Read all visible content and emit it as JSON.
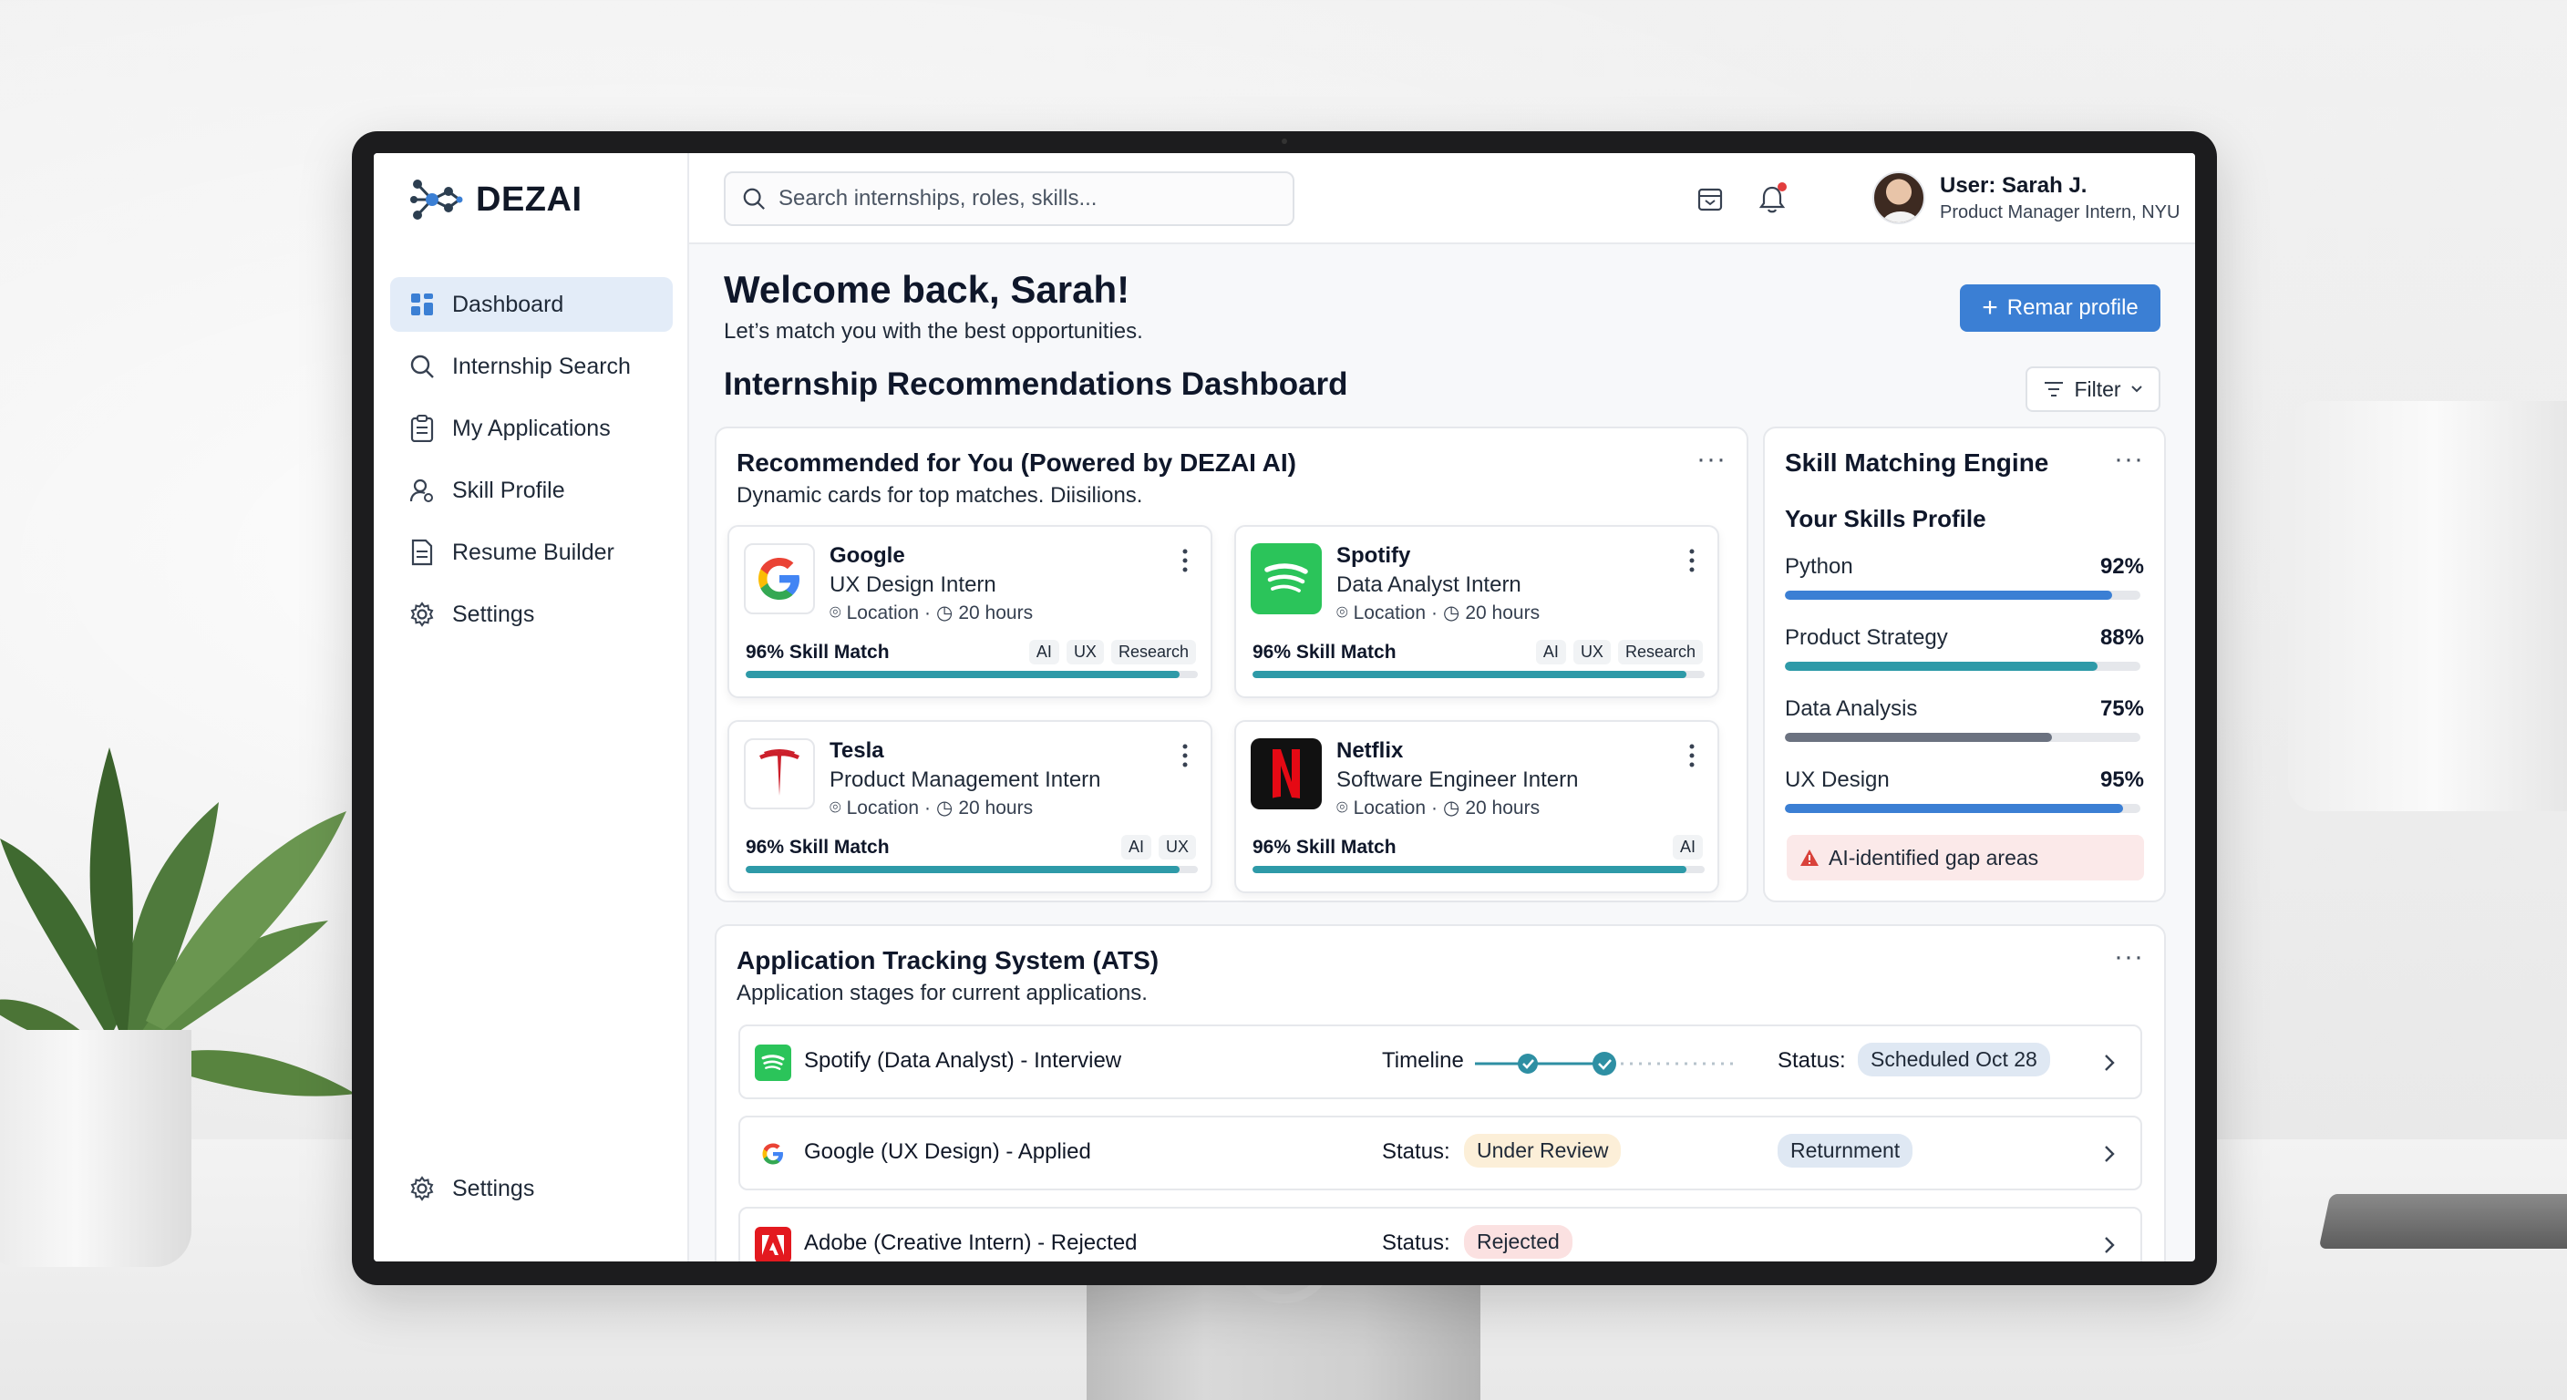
{
  "app": {
    "brand": "DEZAI"
  },
  "sidebar": {
    "items": [
      {
        "label": "Dashboard",
        "icon": "grid-icon",
        "active": true
      },
      {
        "label": "Internship Search",
        "icon": "search-icon"
      },
      {
        "label": "My Applications",
        "icon": "clipboard-icon"
      },
      {
        "label": "Skill Profile",
        "icon": "user-gear-icon"
      },
      {
        "label": "Resume Builder",
        "icon": "document-icon"
      },
      {
        "label": "Settings",
        "icon": "gear-icon"
      }
    ],
    "bottom_item": {
      "label": "Settings",
      "icon": "gear-icon"
    }
  },
  "header": {
    "search_placeholder": "Search internships, roles, skills...",
    "user_name": "User: Sarah J.",
    "user_role": "Product Manager Intern, NYU"
  },
  "main": {
    "welcome": "Welcome back, Sarah!",
    "welcome_sub": "Let’s match you with the best opportunities.",
    "primary_button": "Remar profile",
    "dashboard_title": "Internship Recommendations Dashboard",
    "filter_label": "Filter"
  },
  "recommended": {
    "title": "Recommended for You (Powered by DEZAI AI)",
    "subtitle": "Dynamic cards for top matches. Diisilions.",
    "cards": [
      {
        "company": "Google",
        "role": "UX Design Intern",
        "location": "Location",
        "hours": "20 hours",
        "match_label": "96% Skill Match",
        "match_value": 96,
        "tags": [
          "AI",
          "UX",
          "Research"
        ],
        "logo": "google-logo"
      },
      {
        "company": "Spotify",
        "role": "Data Analyst Intern",
        "location": "Location",
        "hours": "20 hours",
        "match_label": "96% Skill Match",
        "match_value": 96,
        "tags": [
          "AI",
          "UX",
          "Research"
        ],
        "logo": "spotify-logo"
      },
      {
        "company": "Tesla",
        "role": "Product Management Intern",
        "location": "Location",
        "hours": "20 hours",
        "match_label": "96% Skill Match",
        "match_value": 96,
        "tags": [
          "AI",
          "UX"
        ],
        "logo": "tesla-logo"
      },
      {
        "company": "Netflix",
        "role": "Software Engineer Intern",
        "location": "Location",
        "hours": "20 hours",
        "match_label": "96% Skill Match",
        "match_value": 96,
        "tags": [
          "AI"
        ],
        "logo": "netflix-logo"
      }
    ]
  },
  "skills": {
    "title": "Skill Matching Engine",
    "subtitle": "Your Skills Profile",
    "items": [
      {
        "name": "Python",
        "pct_label": "92%",
        "value": 92,
        "color": "#3b7fd4"
      },
      {
        "name": "Product Strategy",
        "pct_label": "88%",
        "value": 88,
        "color": "#2e9aa8"
      },
      {
        "name": "Data Analysis",
        "pct_label": "75%",
        "value": 75,
        "color": "#6b7280"
      },
      {
        "name": "UX Design",
        "pct_label": "95%",
        "value": 95,
        "color": "#3b7fd4"
      }
    ],
    "gap_label": "AI-identified gap areas"
  },
  "ats": {
    "title": "Application Tracking System (ATS)",
    "subtitle": "Application stages for current applications.",
    "rows": [
      {
        "label": "Spotify (Data Analyst) - Interview",
        "logo": "spotify-logo",
        "timeline_label": "Timeline",
        "status_label": "Status:",
        "status_value": "Scheduled Oct 28",
        "status_color": "#dfe8f3"
      },
      {
        "label": "Google (UX Design) - Applied",
        "logo": "google-logo",
        "status_label": "Status:",
        "status_value": "Under Review",
        "status_color": "#fcefd8",
        "extra_pill": "Returnment"
      },
      {
        "label": "Adobe (Creative Intern) - Rejected",
        "logo": "adobe-logo",
        "status_label": "Status:",
        "status_value": "Rejected",
        "status_color": "#fbe1e1"
      }
    ]
  },
  "colors": {
    "accent": "#3b7fd4",
    "teal": "#2e9aa8",
    "active_nav": "#e3ecf8"
  }
}
